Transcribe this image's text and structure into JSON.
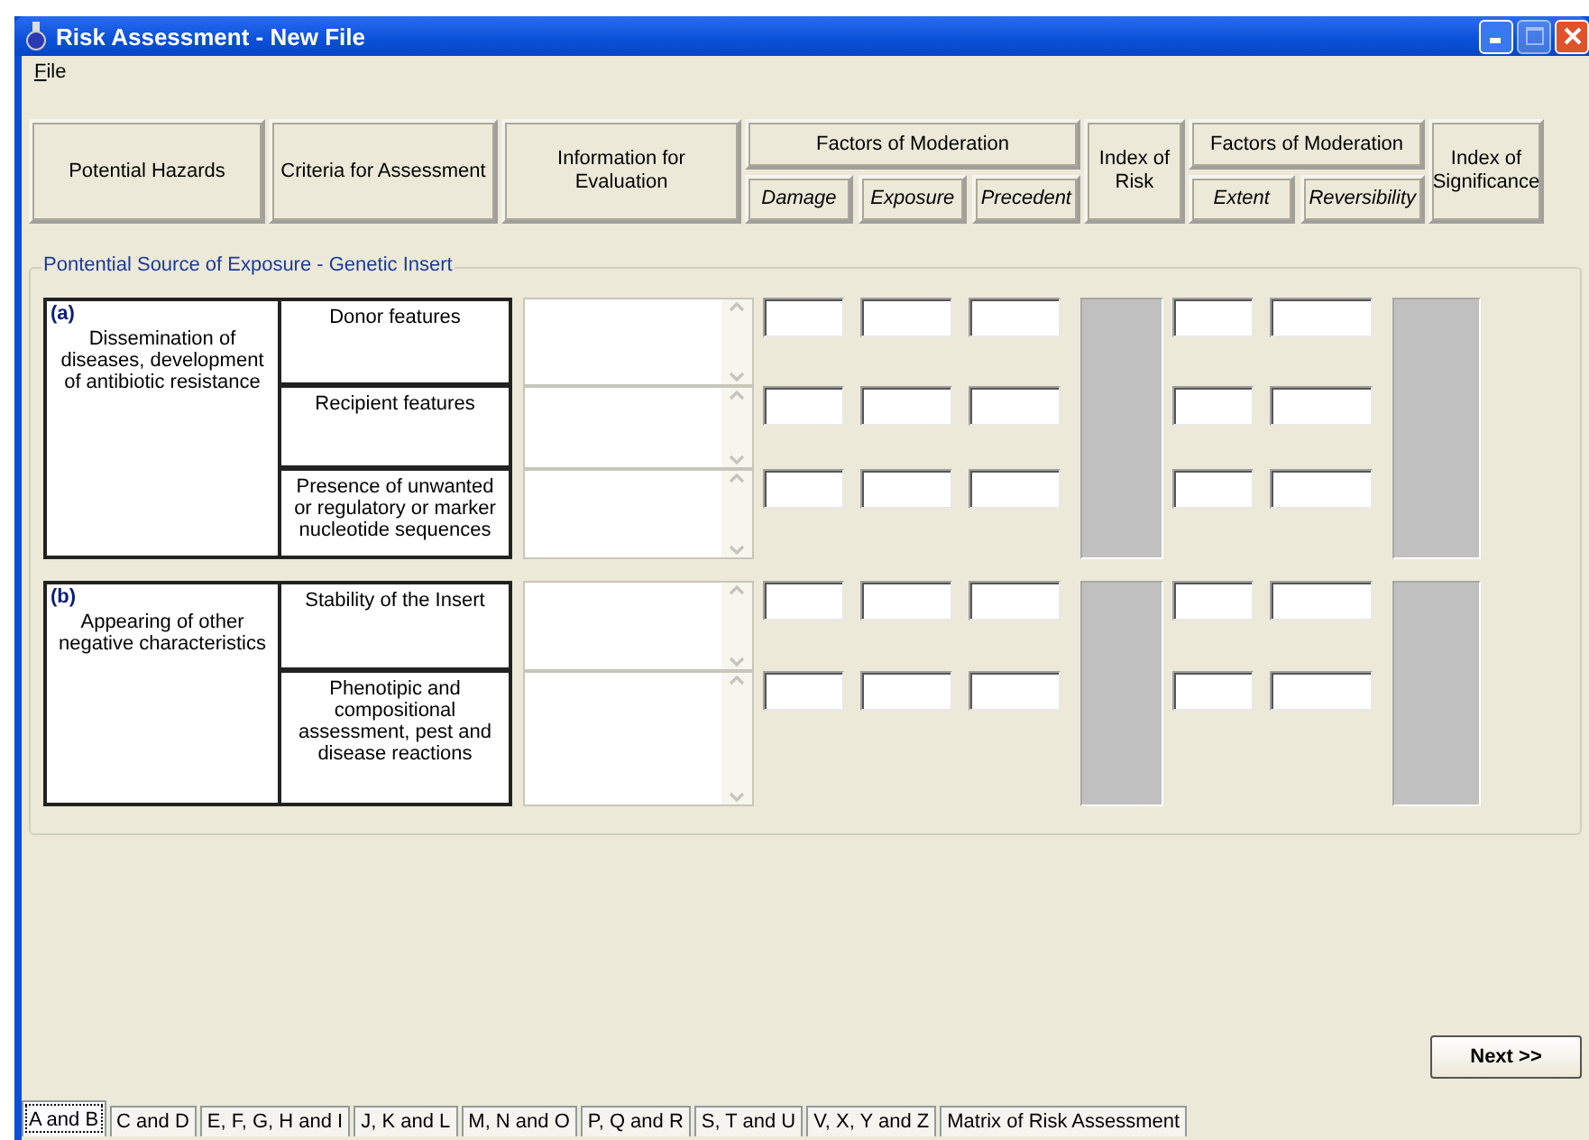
{
  "window": {
    "title": "Risk Assessment - New File"
  },
  "menu": [
    "File"
  ],
  "header": [
    {
      "kind": "single",
      "label": "Potential Hazards"
    },
    {
      "kind": "single",
      "label": "Criteria for Assessment"
    },
    {
      "kind": "single",
      "label": "Information for Evaluation"
    },
    {
      "kind": "group",
      "label": "Factors of Moderation",
      "children": [
        "Damage",
        "Exposure",
        "Precedent"
      ]
    },
    {
      "kind": "single",
      "label": "Index of Risk"
    },
    {
      "kind": "group",
      "label": "Factors of Moderation",
      "children": [
        "Extent",
        "Reversibility"
      ]
    },
    {
      "kind": "single",
      "label": "Index of Significance"
    }
  ],
  "group": {
    "title": "Pontential Source of Exposure - Genetic Insert",
    "sections": [
      {
        "letter": "(a)",
        "hazard": "Dissemination of diseases, development of antibiotic resistance",
        "criteria": [
          "Donor features",
          "Recipient features",
          "Presence of unwanted or regulatory or marker nucleotide sequences"
        ]
      },
      {
        "letter": "(b)",
        "hazard": "Appearing of other negative characteristics",
        "criteria": [
          "Stability of the Insert",
          "Phenotipic and compositional assessment, pest and disease reactions"
        ]
      }
    ]
  },
  "next_button": "Next >>",
  "tabs": [
    {
      "label": "A and B",
      "selected": true
    },
    {
      "label": "C and D",
      "selected": false
    },
    {
      "label": "E, F, G, H and I",
      "selected": false
    },
    {
      "label": "J, K and L",
      "selected": false
    },
    {
      "label": "M, N and O",
      "selected": false
    },
    {
      "label": "P, Q and R",
      "selected": false
    },
    {
      "label": "S, T and U",
      "selected": false
    },
    {
      "label": "V, X, Y and Z",
      "selected": false
    },
    {
      "label": "Matrix of Risk Assessment",
      "selected": false
    }
  ]
}
